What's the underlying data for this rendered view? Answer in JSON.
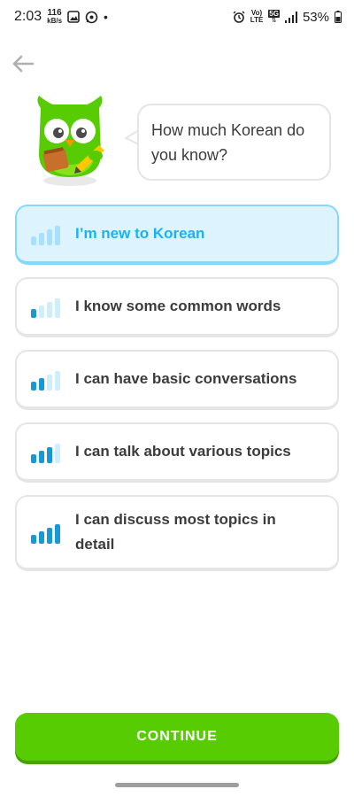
{
  "status_bar": {
    "time": "2:03",
    "net_speed_value": "116",
    "net_speed_unit": "kB/s",
    "volte": "Vo)",
    "lte": "LTE",
    "fiveg": "5G",
    "battery_percent": "53%"
  },
  "prompt": {
    "question": "How much Korean do you know?"
  },
  "options": [
    {
      "label": "I’m new to Korean",
      "level": 0,
      "selected": true
    },
    {
      "label": "I know some common words",
      "level": 1,
      "selected": false
    },
    {
      "label": "I can have basic conversations",
      "level": 2,
      "selected": false
    },
    {
      "label": "I can talk about various topics",
      "level": 3,
      "selected": false
    },
    {
      "label": "I can discuss most topics in detail",
      "level": 4,
      "selected": false
    }
  ],
  "continue_label": "CONTINUE",
  "colors": {
    "brand_green": "#58cc02",
    "selected_blue": "#1cb0f6",
    "selected_bg": "#ddf4ff",
    "bar_active": "#1899d6",
    "bar_inactive": "#cfeefc"
  },
  "icons": {
    "back": "arrow-left-icon",
    "mascot": "duo-owl-icon"
  }
}
